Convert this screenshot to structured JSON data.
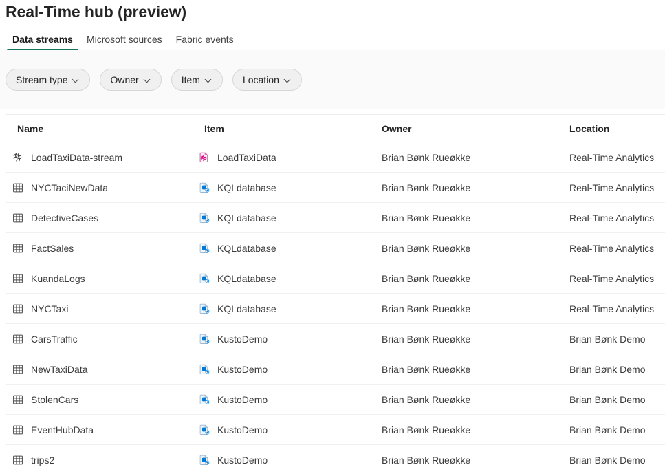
{
  "header": {
    "title": "Real-Time hub (preview)"
  },
  "tabs": [
    {
      "label": "Data streams",
      "active": true
    },
    {
      "label": "Microsoft sources",
      "active": false
    },
    {
      "label": "Fabric events",
      "active": false
    }
  ],
  "filters": [
    {
      "label": "Stream type",
      "icon": "chevron-down-icon"
    },
    {
      "label": "Owner",
      "icon": "chevron-down-icon"
    },
    {
      "label": "Item",
      "icon": "chevron-down-icon"
    },
    {
      "label": "Location",
      "icon": "chevron-down-icon"
    }
  ],
  "table": {
    "columns": [
      {
        "key": "name",
        "label": "Name"
      },
      {
        "key": "item",
        "label": "Item"
      },
      {
        "key": "owner",
        "label": "Owner"
      },
      {
        "key": "location",
        "label": "Location"
      }
    ],
    "rows": [
      {
        "name": "LoadTaxiData-stream",
        "name_icon": "eventstream-icon",
        "item": "LoadTaxiData",
        "item_icon": "eventstream-item-icon",
        "owner": "Brian Bønk Rueøkke",
        "location": "Real-Time Analytics"
      },
      {
        "name": "NYCTaciNewData",
        "name_icon": "table-icon",
        "item": "KQLdatabase",
        "item_icon": "kql-database-icon",
        "owner": "Brian Bønk Rueøkke",
        "location": "Real-Time Analytics"
      },
      {
        "name": "DetectiveCases",
        "name_icon": "table-icon",
        "item": "KQLdatabase",
        "item_icon": "kql-database-icon",
        "owner": "Brian Bønk Rueøkke",
        "location": "Real-Time Analytics"
      },
      {
        "name": "FactSales",
        "name_icon": "table-icon",
        "item": "KQLdatabase",
        "item_icon": "kql-database-icon",
        "owner": "Brian Bønk Rueøkke",
        "location": "Real-Time Analytics"
      },
      {
        "name": "KuandaLogs",
        "name_icon": "table-icon",
        "item": "KQLdatabase",
        "item_icon": "kql-database-icon",
        "owner": "Brian Bønk Rueøkke",
        "location": "Real-Time Analytics"
      },
      {
        "name": "NYCTaxi",
        "name_icon": "table-icon",
        "item": "KQLdatabase",
        "item_icon": "kql-database-icon",
        "owner": "Brian Bønk Rueøkke",
        "location": "Real-Time Analytics"
      },
      {
        "name": "CarsTraffic",
        "name_icon": "table-icon",
        "item": "KustoDemo",
        "item_icon": "kql-database-icon",
        "owner": "Brian Bønk Rueøkke",
        "location": "Brian Bønk Demo"
      },
      {
        "name": "NewTaxiData",
        "name_icon": "table-icon",
        "item": "KustoDemo",
        "item_icon": "kql-database-icon",
        "owner": "Brian Bønk Rueøkke",
        "location": "Brian Bønk Demo"
      },
      {
        "name": "StolenCars",
        "name_icon": "table-icon",
        "item": "KustoDemo",
        "item_icon": "kql-database-icon",
        "owner": "Brian Bønk Rueøkke",
        "location": "Brian Bønk Demo"
      },
      {
        "name": "EventHubData",
        "name_icon": "table-icon",
        "item": "KustoDemo",
        "item_icon": "kql-database-icon",
        "owner": "Brian Bønk Rueøkke",
        "location": "Brian Bønk Demo"
      },
      {
        "name": "trips2",
        "name_icon": "table-icon",
        "item": "KustoDemo",
        "item_icon": "kql-database-icon",
        "owner": "Brian Bønk Rueøkke",
        "location": "Brian Bønk Demo"
      }
    ]
  },
  "colors": {
    "accent_tab_underline": "#11745f",
    "eventstream_icon": "#e3008c",
    "kql_database_icon": "#0078d4",
    "text_primary": "#242424",
    "text_secondary": "#3b3b3b",
    "filter_pill_bg": "#f0f0f0"
  }
}
